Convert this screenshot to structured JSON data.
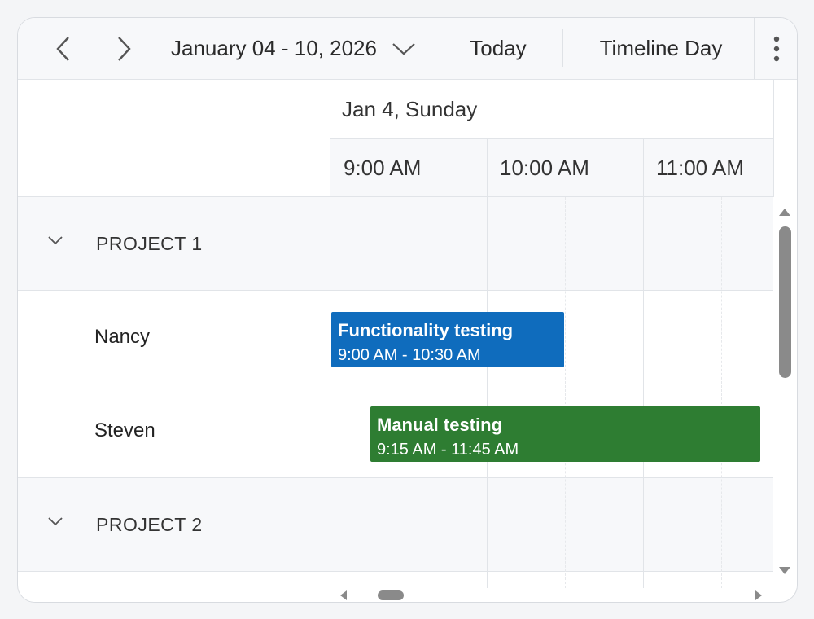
{
  "toolbar": {
    "date_range": "January 04 - 10, 2026",
    "today_label": "Today",
    "view_label": "Timeline Day",
    "icons": {
      "prev": "chevron-left-icon",
      "next": "chevron-right-icon",
      "dropdown": "chevron-down-icon",
      "more": "more-vertical-icon"
    }
  },
  "header": {
    "date_label": "Jan 4, Sunday",
    "time_slots": [
      "9:00 AM",
      "10:00 AM",
      "11:00 AM"
    ]
  },
  "resources": {
    "group1": "PROJECT 1",
    "nancy": "Nancy",
    "steven": "Steven",
    "group2": "PROJECT 2"
  },
  "events": {
    "functionality": {
      "title": "Functionality testing",
      "time": "9:00 AM - 10:30 AM",
      "color": "#0f6cbd"
    },
    "manual": {
      "title": "Manual testing",
      "time": "9:15 AM - 11:45 AM",
      "color": "#2e7d32"
    }
  }
}
